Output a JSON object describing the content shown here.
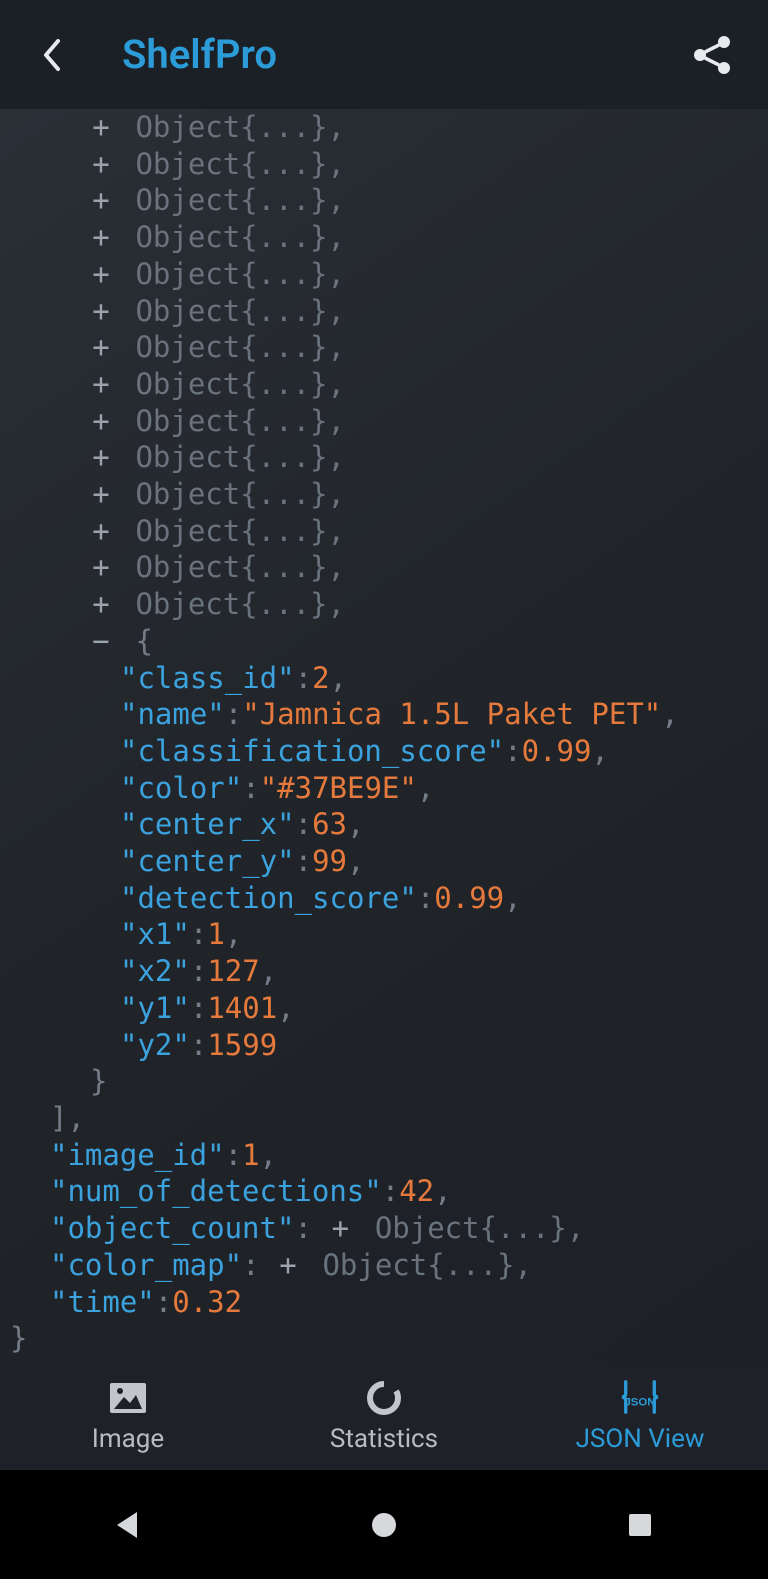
{
  "header": {
    "title": "ShelfPro"
  },
  "json_view": {
    "collapsed_label": "Object{...}",
    "collapsed_count": 14,
    "expanded": {
      "class_id": {
        "key": "\"class_id\"",
        "value": "2"
      },
      "name": {
        "key": "\"name\"",
        "value": "\"Jamnica 1.5L Paket PET\""
      },
      "classification_score": {
        "key": "\"classification_score\"",
        "value": "0.99"
      },
      "color": {
        "key": "\"color\"",
        "value": "\"#37BE9E\""
      },
      "center_x": {
        "key": "\"center_x\"",
        "value": "63"
      },
      "center_y": {
        "key": "\"center_y\"",
        "value": "99"
      },
      "detection_score": {
        "key": "\"detection_score\"",
        "value": "0.99"
      },
      "x1": {
        "key": "\"x1\"",
        "value": "1"
      },
      "x2": {
        "key": "\"x2\"",
        "value": "127"
      },
      "y1": {
        "key": "\"y1\"",
        "value": "1401"
      },
      "y2": {
        "key": "\"y2\"",
        "value": "1599"
      }
    },
    "footer": {
      "image_id": {
        "key": "\"image_id\"",
        "value": "1"
      },
      "num_of_detections": {
        "key": "\"num_of_detections\"",
        "value": "42"
      },
      "object_count": {
        "key": "\"object_count\"",
        "collapsed": "Object{...}"
      },
      "color_map": {
        "key": "\"color_map\"",
        "collapsed": "Object{...}"
      },
      "time": {
        "key": "\"time\"",
        "value": "0.32"
      }
    },
    "array_close": "],",
    "obj_close": "}"
  },
  "tabs": {
    "image": "Image",
    "statistics": "Statistics",
    "json_view": "JSON View"
  }
}
